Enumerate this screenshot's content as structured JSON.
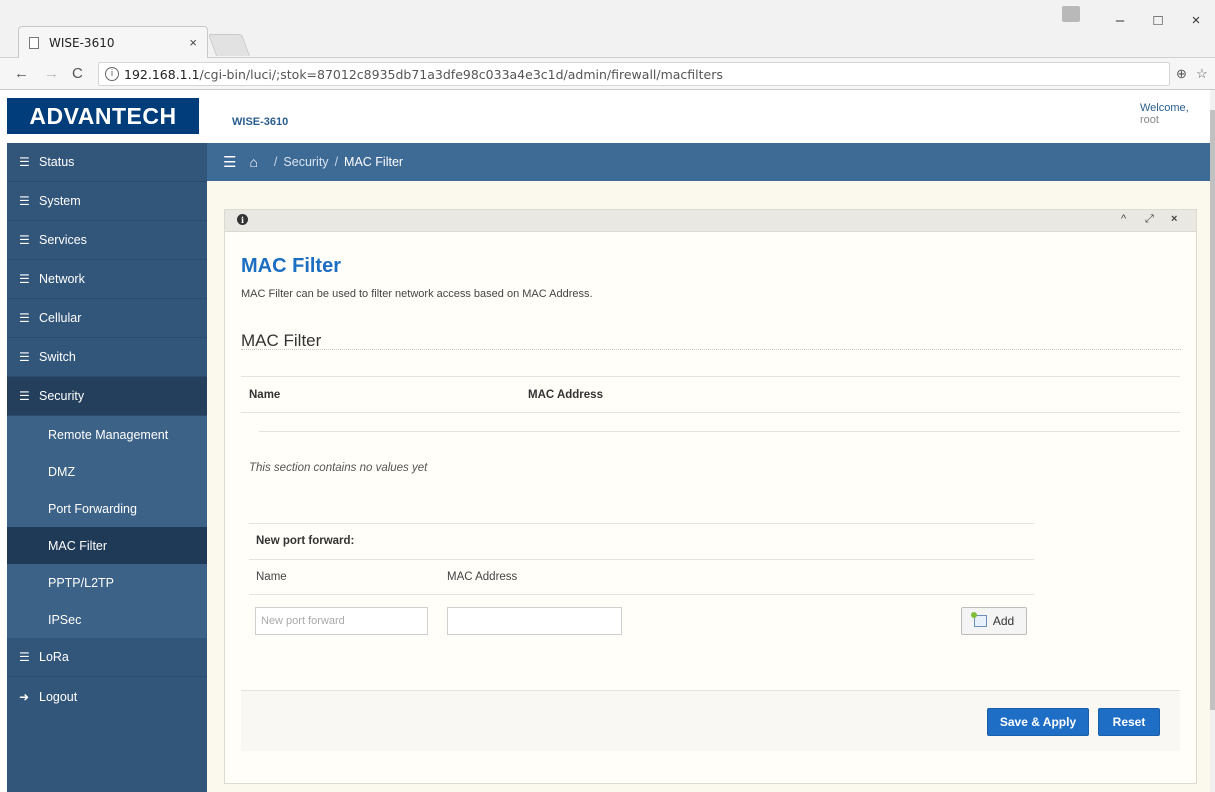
{
  "browser": {
    "tab_title": "WISE-3610",
    "tab_close": "×",
    "url_host": "192.168.1.1",
    "url_path": "/cgi-bin/luci/;stok=87012c8935db71a3dfe98c033a4e3c1d/admin/firewall/macfilters",
    "controls": {
      "minimize": "–",
      "maximize": "□",
      "close": "×"
    }
  },
  "header": {
    "logo_text": "ADVANTECH",
    "product": "WISE-3610",
    "welcome": "Welcome,",
    "user": "root"
  },
  "sidebar": {
    "items": [
      {
        "label": "Status"
      },
      {
        "label": "System"
      },
      {
        "label": "Services"
      },
      {
        "label": "Network"
      },
      {
        "label": "Cellular"
      },
      {
        "label": "Switch"
      },
      {
        "label": "Security"
      }
    ],
    "security_sub": [
      {
        "label": "Remote Management"
      },
      {
        "label": "DMZ"
      },
      {
        "label": "Port Forwarding"
      },
      {
        "label": "MAC Filter"
      },
      {
        "label": "PPTP/L2TP"
      },
      {
        "label": "IPSec"
      }
    ],
    "after": [
      {
        "label": "LoRa"
      },
      {
        "label": "Logout"
      }
    ]
  },
  "breadcrumb": {
    "section": "Security",
    "current": "MAC Filter",
    "separator": "/"
  },
  "page": {
    "title": "MAC Filter",
    "description": "MAC Filter can be used to filter network access based on MAC Address.",
    "section_title": "MAC Filter",
    "columns": [
      "Name",
      "MAC Address"
    ],
    "empty_message": "This section contains no values yet",
    "new_entry": {
      "heading": "New port forward:",
      "name_label": "Name",
      "mac_label": "MAC Address",
      "name_placeholder": "New port forward",
      "mac_value": "",
      "add_label": "Add"
    },
    "buttons": {
      "save_apply": "Save & Apply",
      "reset": "Reset"
    }
  },
  "colors": {
    "sidebar": "#32557a",
    "breadcrumb_bar": "#3e6a96",
    "accent_blue": "#1f6ec5",
    "logo_bg": "#003d7a"
  }
}
